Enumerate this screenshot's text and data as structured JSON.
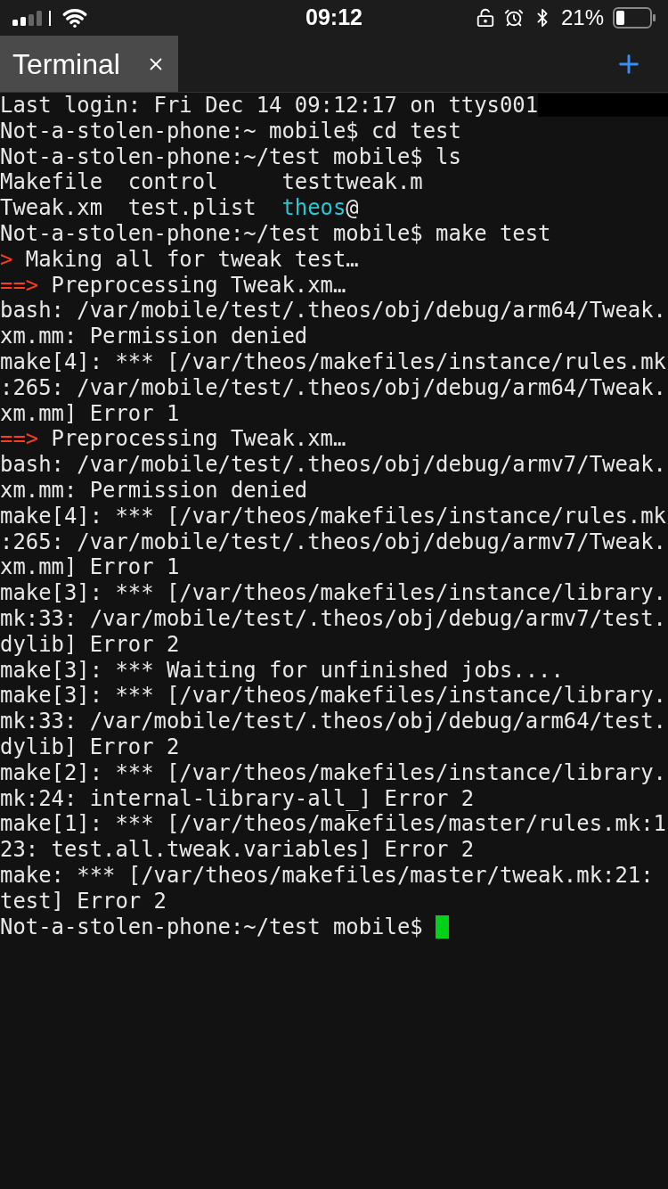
{
  "status_bar": {
    "time": "09:12",
    "battery": "21%"
  },
  "tabs": [
    {
      "label": "Terminal",
      "selected": true
    }
  ],
  "terminal": {
    "lines": [
      [
        {
          "kind": "plain",
          "text": "Last login: Fri Dec 14 09:12:17 on ttys001"
        }
      ],
      [
        {
          "kind": "plain",
          "text": "Not-a-stolen-phone:~ mobile$ cd test"
        }
      ],
      [
        {
          "kind": "plain",
          "text": "Not-a-stolen-phone:~/test mobile$ ls"
        }
      ],
      [
        {
          "kind": "plain",
          "text": "Makefile  control     testtweak.m"
        }
      ],
      [
        {
          "kind": "plain",
          "text": "Tweak.xm  test.plist  "
        },
        {
          "kind": "link",
          "text": "theos"
        },
        {
          "kind": "plain",
          "text": "@"
        }
      ],
      [
        {
          "kind": "plain",
          "text": "Not-a-stolen-phone:~/test mobile$ make test"
        }
      ],
      [
        {
          "kind": "marker",
          "text": ">"
        },
        {
          "kind": "plain",
          "text": " Making all for tweak test…"
        }
      ],
      [
        {
          "kind": "marker",
          "text": "==>"
        },
        {
          "kind": "plain",
          "text": " Preprocessing Tweak.xm…"
        }
      ],
      [
        {
          "kind": "plain",
          "text": "bash: /var/mobile/test/.theos/obj/debug/arm64/Tweak."
        }
      ],
      [
        {
          "kind": "plain",
          "text": "xm.mm: Permission denied"
        }
      ],
      [
        {
          "kind": "plain",
          "text": "make[4]: *** [/var/theos/makefiles/instance/rules.mk"
        }
      ],
      [
        {
          "kind": "plain",
          "text": ":265: /var/mobile/test/.theos/obj/debug/arm64/Tweak."
        }
      ],
      [
        {
          "kind": "plain",
          "text": "xm.mm] Error 1"
        }
      ],
      [
        {
          "kind": "marker",
          "text": "==>"
        },
        {
          "kind": "plain",
          "text": " Preprocessing Tweak.xm…"
        }
      ],
      [
        {
          "kind": "plain",
          "text": "bash: /var/mobile/test/.theos/obj/debug/armv7/Tweak."
        }
      ],
      [
        {
          "kind": "plain",
          "text": "xm.mm: Permission denied"
        }
      ],
      [
        {
          "kind": "plain",
          "text": "make[4]: *** [/var/theos/makefiles/instance/rules.mk"
        }
      ],
      [
        {
          "kind": "plain",
          "text": ":265: /var/mobile/test/.theos/obj/debug/armv7/Tweak."
        }
      ],
      [
        {
          "kind": "plain",
          "text": "xm.mm] Error 1"
        }
      ],
      [
        {
          "kind": "plain",
          "text": "make[3]: *** [/var/theos/makefiles/instance/library."
        }
      ],
      [
        {
          "kind": "plain",
          "text": "mk:33: /var/mobile/test/.theos/obj/debug/armv7/test."
        }
      ],
      [
        {
          "kind": "plain",
          "text": "dylib] Error 2"
        }
      ],
      [
        {
          "kind": "plain",
          "text": "make[3]: *** Waiting for unfinished jobs...."
        }
      ],
      [
        {
          "kind": "plain",
          "text": "make[3]: *** [/var/theos/makefiles/instance/library."
        }
      ],
      [
        {
          "kind": "plain",
          "text": "mk:33: /var/mobile/test/.theos/obj/debug/arm64/test."
        }
      ],
      [
        {
          "kind": "plain",
          "text": "dylib] Error 2"
        }
      ],
      [
        {
          "kind": "plain",
          "text": "make[2]: *** [/var/theos/makefiles/instance/library."
        }
      ],
      [
        {
          "kind": "plain",
          "text": "mk:24: internal-library-all_] Error 2"
        }
      ],
      [
        {
          "kind": "plain",
          "text": "make[1]: *** [/var/theos/makefiles/master/rules.mk:1"
        }
      ],
      [
        {
          "kind": "plain",
          "text": "23: test.all.tweak.variables] Error 2"
        }
      ],
      [
        {
          "kind": "plain",
          "text": "make: *** [/var/theos/makefiles/master/tweak.mk:21:"
        }
      ],
      [
        {
          "kind": "plain",
          "text": "test] Error 2"
        }
      ],
      [
        {
          "kind": "plain",
          "text": "Not-a-stolen-phone:~/test mobile$ "
        },
        {
          "kind": "cursor"
        }
      ]
    ]
  }
}
